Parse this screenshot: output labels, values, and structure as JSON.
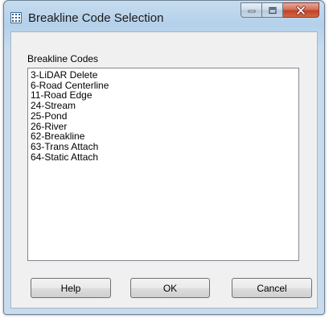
{
  "window": {
    "title": "Breakline Code Selection",
    "icon": "grid-app-icon",
    "caption_buttons": [
      "minimize-icon",
      "maximize-icon",
      "close-icon"
    ]
  },
  "list": {
    "label": "Breakline Codes",
    "items": [
      "3-LiDAR Delete",
      "6-Road Centerline",
      "11-Road Edge",
      "24-Stream",
      "25-Pond",
      "26-River",
      "62-Breakline",
      "63-Trans Attach",
      "64-Static Attach"
    ]
  },
  "buttons": {
    "help": "Help",
    "ok": "OK",
    "cancel": "Cancel"
  },
  "colors": {
    "close_button": "#c7462d",
    "frame": "#b9d1ea",
    "client_background": "#f0f0f0"
  }
}
